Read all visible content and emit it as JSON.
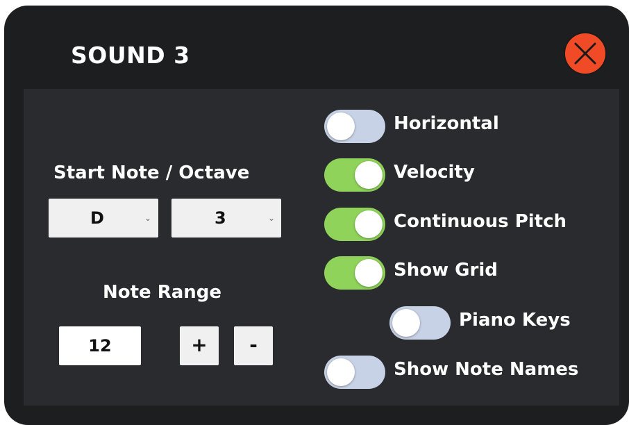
{
  "window": {
    "title": "SOUND 3",
    "close_icon": "close-x-icon",
    "colors": {
      "background": "#1d1e20",
      "panel": "#2a2b2e",
      "close_button": "#f04b26",
      "toggle_on": "#8fd35a",
      "toggle_off": "#c8d2e6"
    }
  },
  "start_note": {
    "label": "Start Note /  Octave",
    "note": {
      "value": "D",
      "chevron": "⌄"
    },
    "octave": {
      "value": "3",
      "chevron": "⌄"
    }
  },
  "note_range": {
    "label": "Note Range",
    "value": "12",
    "plus_label": "+",
    "minus_label": "-"
  },
  "toggles": [
    {
      "label": "Horizontal",
      "on": false
    },
    {
      "label": "Velocity",
      "on": true
    },
    {
      "label": "Continuous Pitch",
      "on": true
    },
    {
      "label": "Show Grid",
      "on": true
    },
    {
      "label": "Piano Keys",
      "on": false
    },
    {
      "label": "Show Note Names",
      "on": false
    }
  ]
}
